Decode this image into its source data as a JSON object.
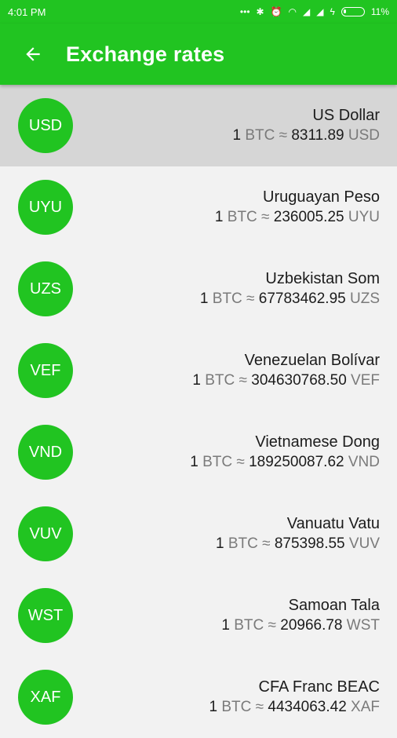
{
  "status_bar": {
    "time": "4:01 PM",
    "battery": "11%"
  },
  "app_bar": {
    "title": "Exchange rates"
  },
  "rates": [
    {
      "code": "USD",
      "name": "US Dollar",
      "base_amount": "1",
      "base": "BTC",
      "approx": "≈",
      "value": "8311.89",
      "quote": "USD",
      "selected": true
    },
    {
      "code": "UYU",
      "name": "Uruguayan Peso",
      "base_amount": "1",
      "base": "BTC",
      "approx": "≈",
      "value": "236005.25",
      "quote": "UYU"
    },
    {
      "code": "UZS",
      "name": "Uzbekistan Som",
      "base_amount": "1",
      "base": "BTC",
      "approx": "≈",
      "value": "67783462.95",
      "quote": "UZS"
    },
    {
      "code": "VEF",
      "name": "Venezuelan Bolívar",
      "base_amount": "1",
      "base": "BTC",
      "approx": "≈",
      "value": "304630768.50",
      "quote": "VEF"
    },
    {
      "code": "VND",
      "name": "Vietnamese Dong",
      "base_amount": "1",
      "base": "BTC",
      "approx": "≈",
      "value": "189250087.62",
      "quote": "VND"
    },
    {
      "code": "VUV",
      "name": "Vanuatu Vatu",
      "base_amount": "1",
      "base": "BTC",
      "approx": "≈",
      "value": "875398.55",
      "quote": "VUV"
    },
    {
      "code": "WST",
      "name": "Samoan Tala",
      "base_amount": "1",
      "base": "BTC",
      "approx": "≈",
      "value": "20966.78",
      "quote": "WST"
    },
    {
      "code": "XAF",
      "name": "CFA Franc BEAC",
      "base_amount": "1",
      "base": "BTC",
      "approx": "≈",
      "value": "4434063.42",
      "quote": "XAF"
    }
  ],
  "colors": {
    "accent": "#21c421",
    "selected_row": "#d6d6d6",
    "background": "#f2f2f2"
  }
}
